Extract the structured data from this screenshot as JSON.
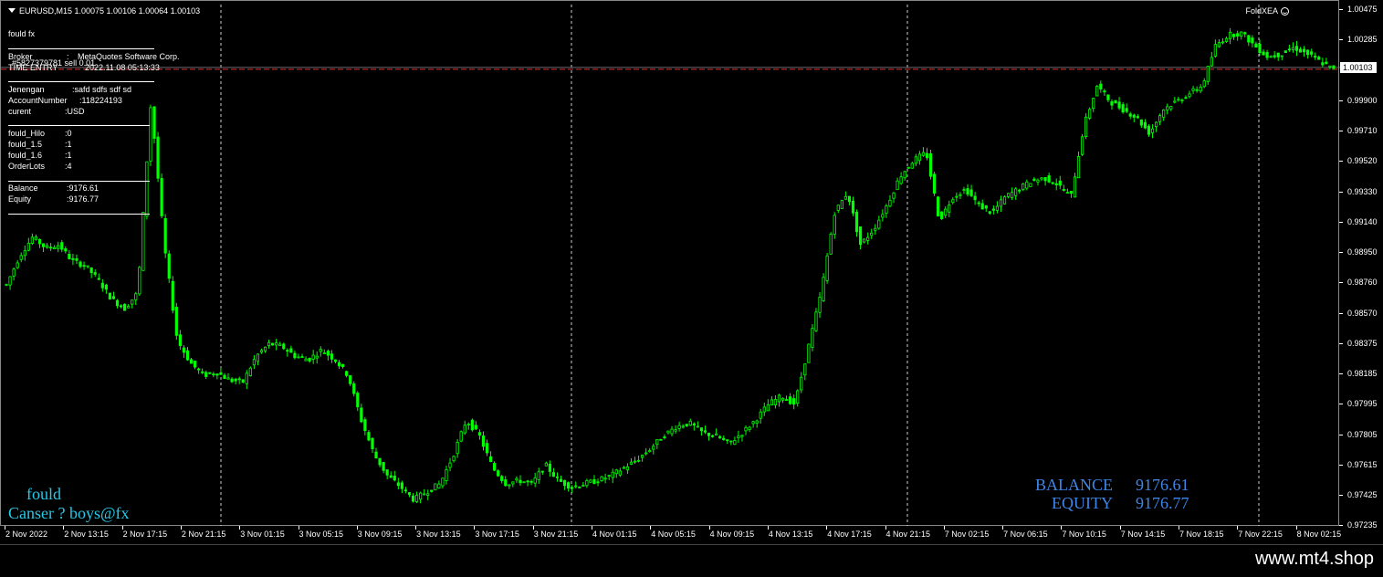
{
  "symbol": {
    "header": "EURUSD,M15  1.00075 1.00106 1.00064 1.00103"
  },
  "ea_name": "FoldXEA",
  "info_panel": {
    "title": "fould fx",
    "broker_label": "Broker",
    "broker_sep": ":",
    "broker_value": "MetaQuotes Software Corp.",
    "overlay_order": "#5827379781 sell 0.01",
    "overlay_time_label": "TIME ENTRY",
    "overlay_time_value": "2022.11.08 05:13:33",
    "account": [
      {
        "k": "Jenengan",
        "v": ":safd    sdfs sdf   sd"
      },
      {
        "k": "AccountNumber",
        "v": ":118224193"
      },
      {
        "k": "curent",
        "v": ":USD"
      }
    ],
    "params": [
      {
        "k": "fould_Hilo",
        "v": ":0"
      },
      {
        "k": "fould_1.5",
        "v": ":1"
      },
      {
        "k": "fould_1.6",
        "v": ":1"
      },
      {
        "k": "OrderLots",
        "v": ":4"
      }
    ],
    "balance": [
      {
        "k": "Balance",
        "v": ":9176.61"
      },
      {
        "k": "Equity",
        "v": ":9176.77"
      }
    ]
  },
  "branding": {
    "line1": "fould",
    "line2": "Canser ? boys@fx"
  },
  "summary": {
    "balance_label": "BALANCE",
    "balance_value": "9176.61",
    "equity_label": "EQUITY",
    "equity_value": "9176.77"
  },
  "price_scale": {
    "labels": [
      "1.00475",
      "1.00285",
      "1.00103",
      "0.99900",
      "0.99710",
      "0.99520",
      "0.99330",
      "0.99140",
      "0.98950",
      "0.98760",
      "0.98570",
      "0.98375",
      "0.98185",
      "0.97995",
      "0.97805",
      "0.97615",
      "0.97425",
      "0.97235"
    ],
    "current": "1.00103"
  },
  "time_scale": {
    "labels": [
      "2 Nov 2022",
      "2 Nov 13:15",
      "2 Nov 17:15",
      "2 Nov 21:15",
      "3 Nov 01:15",
      "3 Nov 05:15",
      "3 Nov 09:15",
      "3 Nov 13:15",
      "3 Nov 17:15",
      "3 Nov 21:15",
      "4 Nov 01:15",
      "4 Nov 05:15",
      "4 Nov 09:15",
      "4 Nov 13:15",
      "4 Nov 17:15",
      "4 Nov 21:15",
      "7 Nov 02:15",
      "7 Nov 06:15",
      "7 Nov 10:15",
      "7 Nov 14:15",
      "7 Nov 18:15",
      "7 Nov 22:15",
      "8 Nov 02:15"
    ]
  },
  "colors": {
    "candle": "#00ff00",
    "background": "#000000",
    "grid": "#ffffff",
    "entry_line": "#d93030",
    "brand": "#27c9e8",
    "summary": "#3d86e8"
  },
  "chart_data": {
    "type": "line",
    "title": "EURUSD,M15",
    "xlabel": "",
    "ylabel": "",
    "ylim": [
      0.97235,
      1.00475
    ],
    "grid": "vertical day separators",
    "series": [
      {
        "values": [
          0.9875,
          0.9893,
          0.9905,
          0.9898,
          0.99,
          0.989,
          0.9887,
          0.9878,
          0.9866,
          0.986,
          0.987,
          0.999,
          0.99,
          0.984,
          0.9826,
          0.9818,
          0.982,
          0.9815,
          0.9814,
          0.983,
          0.9838,
          0.9836,
          0.983,
          0.9828,
          0.9834,
          0.9828,
          0.9818,
          0.979,
          0.9768,
          0.9755,
          0.9748,
          0.974,
          0.9745,
          0.975,
          0.9768,
          0.979,
          0.978,
          0.976,
          0.975,
          0.9752,
          0.975,
          0.9762,
          0.9752,
          0.9748,
          0.975,
          0.9752,
          0.9755,
          0.976,
          0.9765,
          0.9772,
          0.978,
          0.9786,
          0.9788,
          0.9782,
          0.978,
          0.9775,
          0.9782,
          0.979,
          0.98,
          0.9805,
          0.98,
          0.9835,
          0.987,
          0.992,
          0.9933,
          0.99,
          0.991,
          0.9925,
          0.9943,
          0.9953,
          0.9958,
          0.9915,
          0.993,
          0.9935,
          0.9925,
          0.992,
          0.993,
          0.9935,
          0.994,
          0.9942,
          0.9938,
          0.993,
          0.9975,
          1.0,
          0.999,
          0.9985,
          0.998,
          0.997,
          0.9985,
          0.999,
          0.9995,
          1.0,
          1.0025,
          1.0032,
          1.0033,
          1.0025,
          1.0018,
          1.002,
          1.0024,
          1.002,
          1.0015,
          1.001
        ]
      }
    ]
  }
}
